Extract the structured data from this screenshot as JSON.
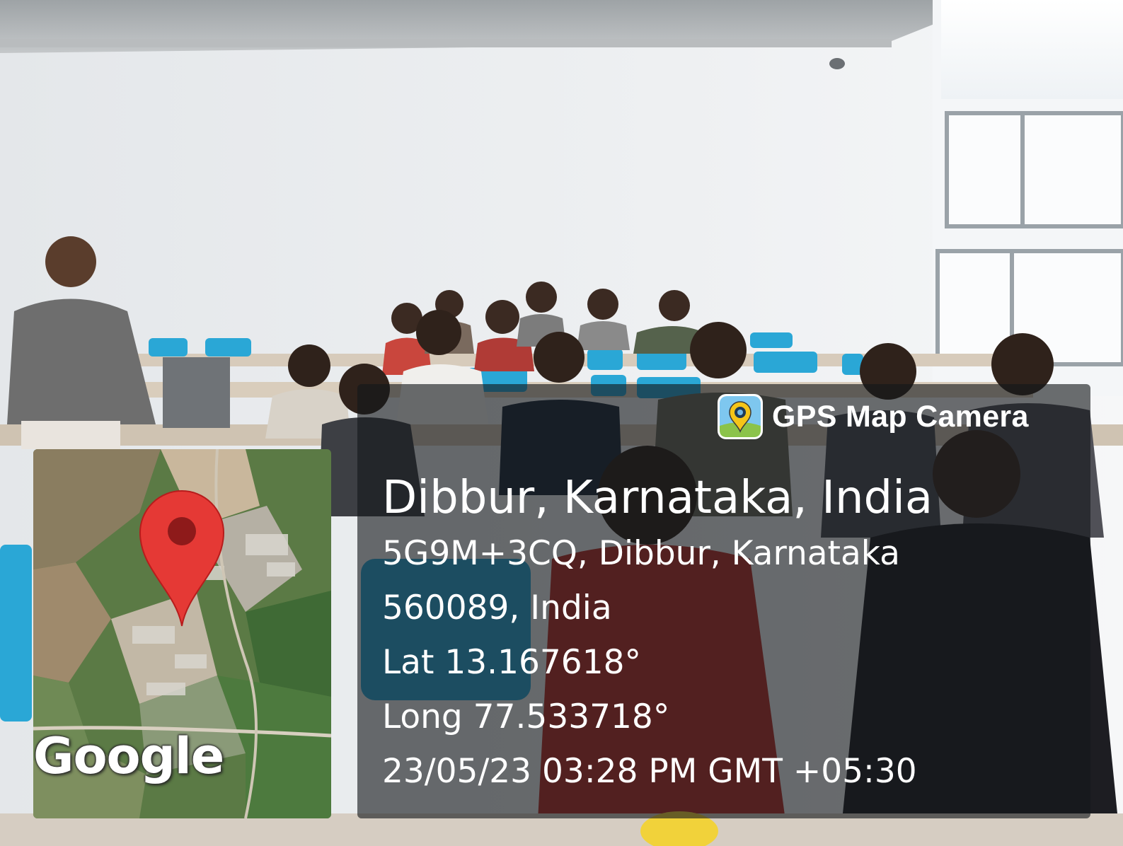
{
  "watermark": {
    "app_name": "GPS Map Camera",
    "place": "Dibbur, Karnataka, India",
    "address_line1": "5G9M+3CQ, Dibbur, Karnataka",
    "address_line2": "560089, India",
    "latitude": "Lat 13.167618°",
    "longitude": "Long 77.533718°",
    "datetime": "23/05/23 03:28 PM GMT +05:30",
    "map_logo": "Google"
  },
  "icons": {
    "app_icon": "gps-camera-icon",
    "map_pin": "map-pin-icon"
  },
  "colors": {
    "panel": "#14161a",
    "pin": "#e53935",
    "seat": "#2aa7d6",
    "wall": "#e9ecef"
  }
}
